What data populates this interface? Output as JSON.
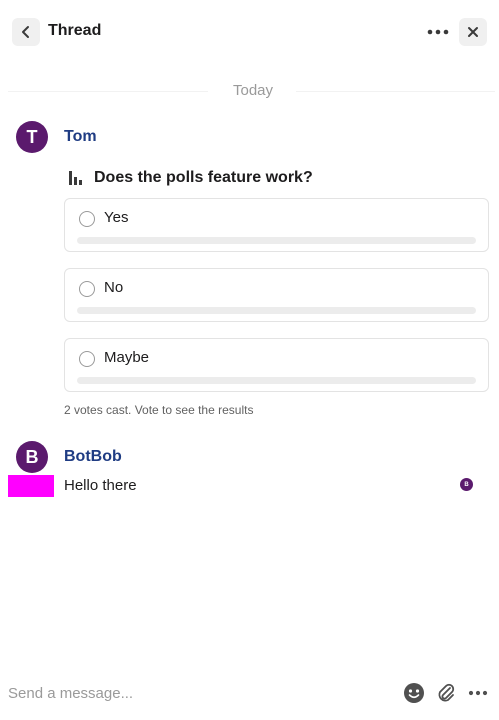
{
  "header": {
    "title": "Thread",
    "back_icon": "chevron-left-icon",
    "more_icon": "more-horizontal-icon",
    "close_icon": "close-icon"
  },
  "date_divider": "Today",
  "messages": [
    {
      "avatar_initial": "T",
      "author": "Tom",
      "poll": {
        "icon": "bar-chart-icon",
        "question": "Does the polls feature work?",
        "options": [
          {
            "label": "Yes",
            "progress": 0
          },
          {
            "label": "No",
            "progress": 0
          },
          {
            "label": "Maybe",
            "progress": 0
          }
        ],
        "footer": "2 votes cast. Vote to see the results"
      }
    },
    {
      "avatar_initial": "B",
      "author": "BotBob",
      "text": "Hello there",
      "read_receipt_initial": "B"
    }
  ],
  "composer": {
    "placeholder": "Send a message...",
    "emoji_icon": "emoji-icon",
    "attach_icon": "paperclip-icon",
    "more_icon": "more-horizontal-icon"
  },
  "colors": {
    "avatar": "#5b1a6d",
    "author": "#1f3c83",
    "text": "#1d1c1d",
    "muted": "#9a9a9a",
    "marker": "#ff00ff"
  }
}
